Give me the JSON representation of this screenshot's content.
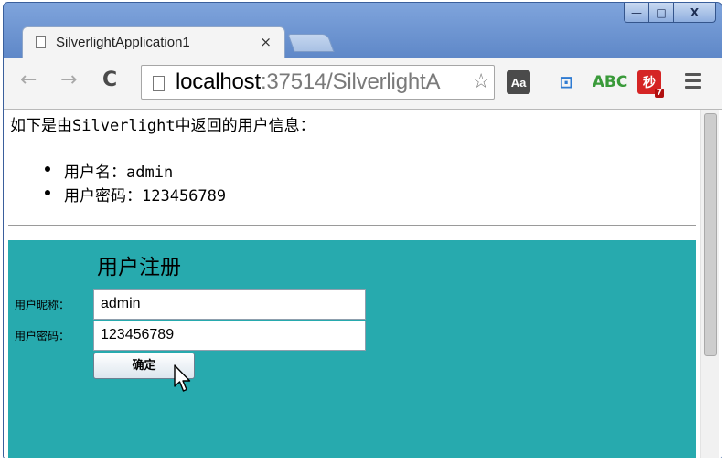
{
  "window": {
    "controls": {
      "minimize": "—",
      "maximize": "□",
      "close": "X"
    }
  },
  "tab": {
    "title": "SilverlightApplication1",
    "close": "×"
  },
  "toolbar": {
    "back": "←",
    "forward": "→",
    "reload": "C",
    "url_host": "localhost",
    "url_rest": ":37514/SilverlightA",
    "star": "☆",
    "extensions": {
      "aa": "Aa",
      "blue": "⊡",
      "abc": "ABC",
      "miao": "秒",
      "miao_badge": "7"
    }
  },
  "page": {
    "intro": "如下是由Silverlight中返回的用户信息：",
    "info_items": [
      {
        "label": "用户名：admin"
      },
      {
        "label": "用户密码：123456789"
      }
    ]
  },
  "silverlight": {
    "title": "用户注册",
    "nickname_label": "用户昵称：",
    "nickname_value": "admin",
    "password_label": "用户密码：",
    "password_value": "123456789",
    "submit_label": "确定"
  },
  "colors": {
    "silverlight_bg": "#27aaae",
    "window_frame": "#6c93cf"
  }
}
